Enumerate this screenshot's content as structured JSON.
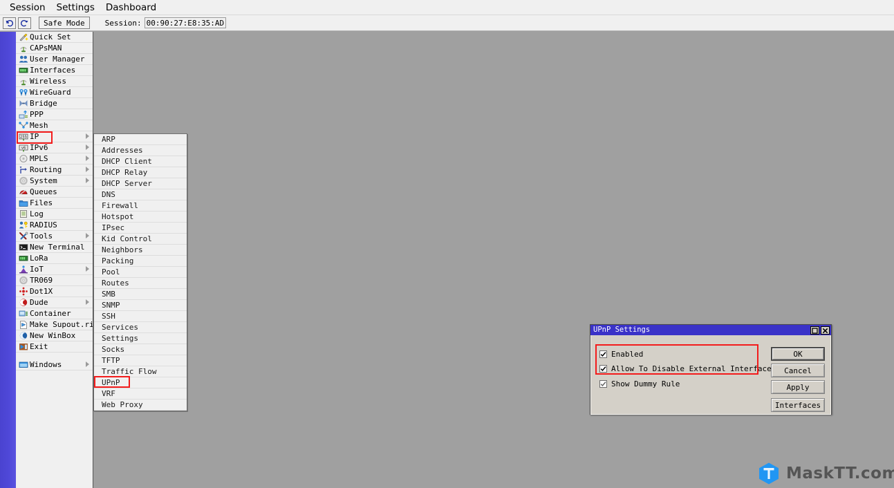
{
  "menubar": {
    "items": [
      {
        "label": "Session",
        "name": "menu-session"
      },
      {
        "label": "Settings",
        "name": "menu-settings"
      },
      {
        "label": "Dashboard",
        "name": "menu-dashboard"
      }
    ]
  },
  "toolbar": {
    "undo_icon": "undo-arrow-icon",
    "redo_icon": "redo-arrow-icon",
    "safe_mode_label": "Safe Mode",
    "session_label": "Session:",
    "session_value": "00:90:27:E8:35:AD"
  },
  "sidebar": {
    "items": [
      {
        "label": "Quick Set",
        "icon": "magic-wand-icon",
        "arrow": false
      },
      {
        "label": "CAPsMAN",
        "icon": "antenna-icon",
        "arrow": false
      },
      {
        "label": "User Manager",
        "icon": "users-icon",
        "arrow": false
      },
      {
        "label": "Interfaces",
        "icon": "interfaces-icon",
        "arrow": false
      },
      {
        "label": "Wireless",
        "icon": "antenna-icon",
        "arrow": false
      },
      {
        "label": "WireGuard",
        "icon": "wireguard-icon",
        "arrow": false
      },
      {
        "label": "Bridge",
        "icon": "bridge-icon",
        "arrow": false
      },
      {
        "label": "PPP",
        "icon": "ppp-icon",
        "arrow": false
      },
      {
        "label": "Mesh",
        "icon": "mesh-icon",
        "arrow": false
      },
      {
        "label": "IP",
        "icon": "ip-255-icon",
        "arrow": true
      },
      {
        "label": "IPv6",
        "icon": "ipv6-icon",
        "arrow": true
      },
      {
        "label": "MPLS",
        "icon": "mpls-icon",
        "arrow": true
      },
      {
        "label": "Routing",
        "icon": "routing-icon",
        "arrow": true
      },
      {
        "label": "System",
        "icon": "gear-icon",
        "arrow": true
      },
      {
        "label": "Queues",
        "icon": "queues-icon",
        "arrow": false
      },
      {
        "label": "Files",
        "icon": "folder-icon",
        "arrow": false
      },
      {
        "label": "Log",
        "icon": "log-icon",
        "arrow": false
      },
      {
        "label": "RADIUS",
        "icon": "radius-key-icon",
        "arrow": false
      },
      {
        "label": "Tools",
        "icon": "tools-icon",
        "arrow": true
      },
      {
        "label": "New Terminal",
        "icon": "terminal-icon",
        "arrow": false
      },
      {
        "label": "LoRa",
        "icon": "lora-icon",
        "arrow": false
      },
      {
        "label": "IoT",
        "icon": "iot-icon",
        "arrow": true
      },
      {
        "label": "TR069",
        "icon": "tr069-gear-icon",
        "arrow": false
      },
      {
        "label": "Dot1X",
        "icon": "dot1x-icon",
        "arrow": false
      },
      {
        "label": "Dude",
        "icon": "dude-icon",
        "arrow": true
      },
      {
        "label": "Container",
        "icon": "container-icon",
        "arrow": false
      },
      {
        "label": "Make Supout.rif",
        "icon": "supout-icon",
        "arrow": false
      },
      {
        "label": "New WinBox",
        "icon": "winbox-icon",
        "arrow": false
      },
      {
        "label": "Exit",
        "icon": "exit-icon",
        "arrow": false
      }
    ],
    "windows_item": {
      "label": "Windows",
      "icon": "window-icon",
      "arrow": true
    },
    "highlight_color": "#f31b1b"
  },
  "submenu": {
    "parent": "IP",
    "items": [
      {
        "label": "ARP"
      },
      {
        "label": "Addresses"
      },
      {
        "label": "DHCP Client"
      },
      {
        "label": "DHCP Relay"
      },
      {
        "label": "DHCP Server"
      },
      {
        "label": "DNS"
      },
      {
        "label": "Firewall"
      },
      {
        "label": "Hotspot"
      },
      {
        "label": "IPsec"
      },
      {
        "label": "Kid Control"
      },
      {
        "label": "Neighbors"
      },
      {
        "label": "Packing"
      },
      {
        "label": "Pool"
      },
      {
        "label": "Routes"
      },
      {
        "label": "SMB"
      },
      {
        "label": "SNMP"
      },
      {
        "label": "SSH"
      },
      {
        "label": "Services"
      },
      {
        "label": "Settings"
      },
      {
        "label": "Socks"
      },
      {
        "label": "TFTP"
      },
      {
        "label": "Traffic Flow"
      },
      {
        "label": "UPnP"
      },
      {
        "label": "VRF"
      },
      {
        "label": "Web Proxy"
      }
    ],
    "highlighted": "UPnP"
  },
  "dialog": {
    "title": "UPnP Settings",
    "titlebar_color": "#3a32c8",
    "maximize_icon": "maximize-icon",
    "close_icon": "close-icon",
    "checkboxes": [
      {
        "label": "Enabled",
        "checked": true
      },
      {
        "label": "Allow To Disable External Interface",
        "checked": true
      },
      {
        "label": "Show Dummy Rule",
        "checked": true
      }
    ],
    "buttons": [
      {
        "label": "OK",
        "default": true
      },
      {
        "label": "Cancel",
        "default": false
      },
      {
        "label": "Apply",
        "default": false
      },
      {
        "label": "Interfaces",
        "default": false
      }
    ],
    "highlight_color": "#f31b1b"
  },
  "watermark": {
    "mark_letter": "T",
    "text": "MaskTT.com",
    "hex_color": "#2196f3",
    "text_color": "#555555"
  }
}
